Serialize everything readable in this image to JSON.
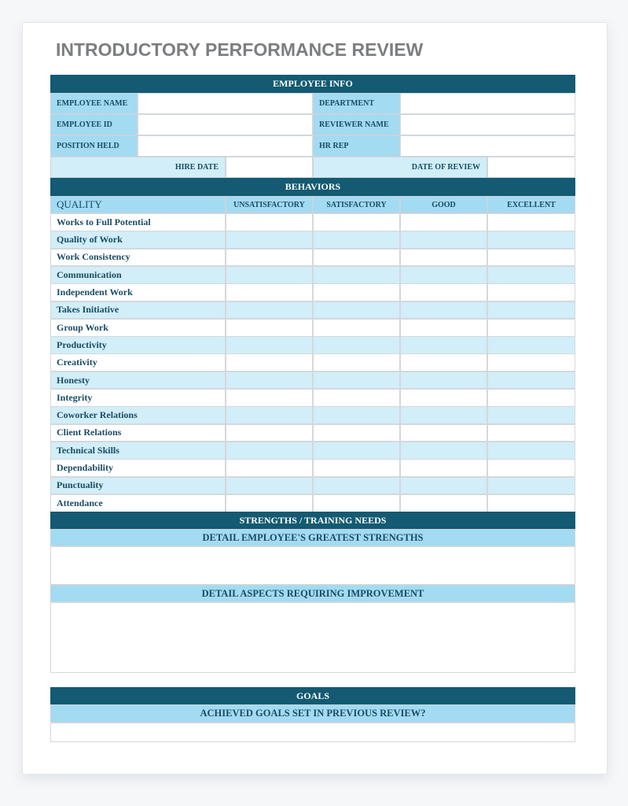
{
  "title": "INTRODUCTORY PERFORMANCE REVIEW",
  "employee_info": {
    "header": "EMPLOYEE INFO",
    "fields": [
      {
        "label": "EMPLOYEE NAME",
        "value": ""
      },
      {
        "label": "DEPARTMENT",
        "value": ""
      },
      {
        "label": "EMPLOYEE ID",
        "value": ""
      },
      {
        "label": "REVIEWER NAME",
        "value": ""
      },
      {
        "label": "POSITION HELD",
        "value": ""
      },
      {
        "label": "HR REP",
        "value": ""
      }
    ],
    "hire_date": {
      "label": "HIRE DATE",
      "value": ""
    },
    "date_of_review": {
      "label": "DATE OF REVIEW",
      "value": ""
    }
  },
  "behaviors": {
    "header": "BEHAVIORS",
    "columns": [
      "QUALITY",
      "UNSATISFACTORY",
      "SATISFACTORY",
      "GOOD",
      "EXCELLENT"
    ],
    "rows": [
      "Works to Full Potential",
      "Quality of Work",
      "Work Consistency",
      "Communication",
      "Independent Work",
      "Takes Initiative",
      "Group Work",
      "Productivity",
      "Creativity",
      "Honesty",
      "Integrity",
      "Coworker Relations",
      "Client Relations",
      "Technical Skills",
      "Dependability",
      "Punctuality",
      "Attendance"
    ]
  },
  "strengths": {
    "header": "STRENGTHS / TRAINING NEEDS",
    "greatest_strengths_label": "DETAIL EMPLOYEE'S GREATEST STRENGTHS",
    "greatest_strengths_value": "",
    "improvement_label": "DETAIL ASPECTS REQUIRING IMPROVEMENT",
    "improvement_value": ""
  },
  "goals": {
    "header": "GOALS",
    "achieved_label": "ACHIEVED GOALS SET IN PREVIOUS REVIEW?",
    "achieved_value": ""
  },
  "colors": {
    "header_dark": "#135a72",
    "header_light": "#a2dbf2",
    "row_alt": "#d1eef9",
    "title_gray": "#7c7e80"
  }
}
